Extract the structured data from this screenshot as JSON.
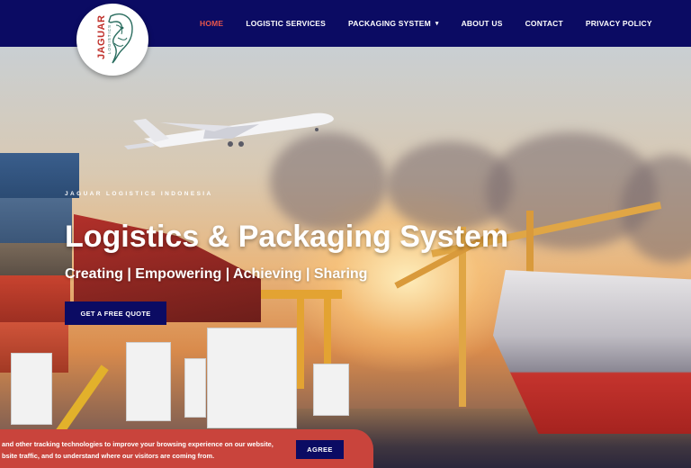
{
  "brand": {
    "logo_text": "JAGUAR",
    "logo_subtext": "LOGISTICS"
  },
  "nav": {
    "items": [
      {
        "label": "HOME",
        "active": true
      },
      {
        "label": "LOGISTIC SERVICES",
        "active": false
      },
      {
        "label": "PACKAGING SYSTEM",
        "active": false,
        "dropdown": true
      },
      {
        "label": "ABOUT US",
        "active": false
      },
      {
        "label": "CONTACT",
        "active": false
      },
      {
        "label": "PRIVACY POLICY",
        "active": false
      }
    ],
    "dropdown_icon": "chevron-down-icon"
  },
  "hero": {
    "kicker": "JAGUAR LOGISTICS INDONESIA",
    "title": "Logistics & Packaging System",
    "subtitle": "Creating | Empowering | Achieving | Sharing",
    "cta_label": "GET A FREE QUOTE"
  },
  "cookie": {
    "line1": "and other tracking technologies to improve your browsing experience on our website,",
    "line2": "bsite traffic, and to understand where our visitors are coming from.",
    "agree_label": "AGREE"
  },
  "colors": {
    "header_bg": "#0b0b63",
    "active_nav": "#e8564b",
    "cookie_bg": "#c9443c",
    "button_bg": "#0b0b63"
  }
}
